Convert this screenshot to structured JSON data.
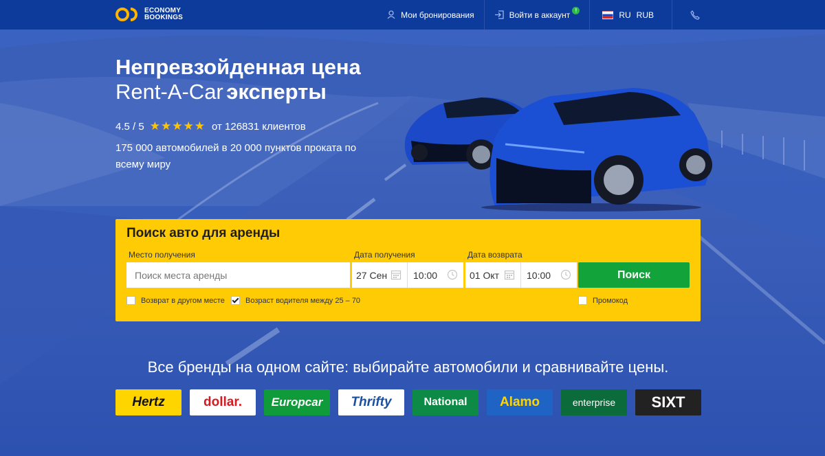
{
  "header": {
    "logo_line1": "ECONOMY",
    "logo_line2": "BOOKINGS",
    "nav": {
      "bookings": "Мои бронирования",
      "login": "Войти в аккаунт",
      "login_badge": "!",
      "language": "RU",
      "currency": "RUB"
    }
  },
  "hero": {
    "title_line1": "Непревзойденная цена",
    "title_line2_regular": "Rent-A-Car",
    "title_line2_bold": "эксперты",
    "rating": "4.5 / 5",
    "rating_stars": 5,
    "clients": "от 126831 клиентов",
    "tagline": "175 000 автомобилей в 20 000 пунктов проката по всему миру"
  },
  "search": {
    "title": "Поиск авто для аренды",
    "pickup_location_label": "Место получения",
    "pickup_location_placeholder": "Поиск места аренды",
    "pickup_date_label": "Дата получения",
    "pickup_date": "27 Сен",
    "pickup_time": "10:00",
    "return_date_label": "Дата возврата",
    "return_date": "01 Окт",
    "return_time": "10:00",
    "search_button": "Поиск",
    "return_elsewhere_label": "Возврат в другом месте",
    "return_elsewhere_checked": false,
    "driver_age_label": "Возраст водителя между 25 – 70",
    "driver_age_checked": true,
    "promo_label": "Промокод",
    "promo_checked": false
  },
  "brands": {
    "heading": "Все бренды на одном сайте: выбирайте автомобили и сравнивайте цены.",
    "items": [
      {
        "name": "Hertz",
        "bg": "#ffd500",
        "fg": "#111111"
      },
      {
        "name": "dollar.",
        "bg": "#ffffff",
        "fg": "#d71920"
      },
      {
        "name": "Europcar",
        "bg": "#0f9b3a",
        "fg": "#ffffff"
      },
      {
        "name": "Thrifty",
        "bg": "#ffffff",
        "fg": "#1b4fa0"
      },
      {
        "name": "National",
        "bg": "#0d8a45",
        "fg": "#ffffff"
      },
      {
        "name": "Alamo",
        "bg": "#1f63c4",
        "fg": "#ffd500"
      },
      {
        "name": "enterprise",
        "bg": "#0b6b3a",
        "fg": "#ffffff"
      },
      {
        "name": "SIXT",
        "bg": "#222222",
        "fg": "#ffffff"
      }
    ]
  },
  "colors": {
    "topbar": "#0d3b9c",
    "panel": "#ffcb05",
    "search_button": "#12a33a",
    "stars": "#ffc400"
  }
}
